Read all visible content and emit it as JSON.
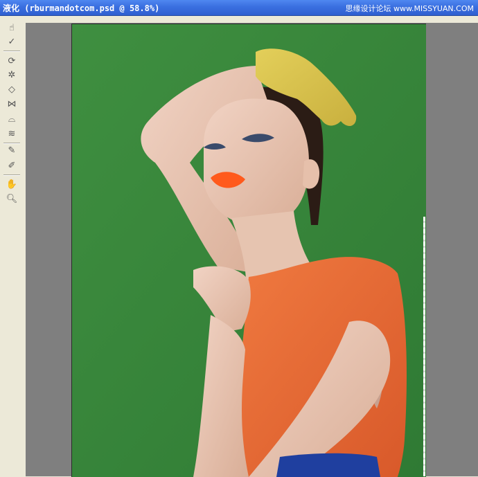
{
  "window": {
    "title": "液化 (rburmandotcom.psd @ 58.8%)",
    "watermark": "思缘设计论坛 www.MISSYUAN.COM"
  },
  "tools": [
    {
      "name": "forward-warp-tool",
      "glyph": "☝"
    },
    {
      "name": "reconstruct-tool",
      "glyph": "✓"
    },
    {
      "name": "twirl-clockwise-tool",
      "glyph": "⟳"
    },
    {
      "name": "pucker-tool",
      "glyph": "✲"
    },
    {
      "name": "bloat-tool",
      "glyph": "◇"
    },
    {
      "name": "push-left-tool",
      "glyph": "⋈"
    },
    {
      "name": "mirror-tool",
      "glyph": "⌓"
    },
    {
      "name": "turbulence-tool",
      "glyph": "≋"
    },
    {
      "name": "freeze-mask-tool",
      "glyph": "✎"
    },
    {
      "name": "thaw-mask-tool",
      "glyph": "✐"
    },
    {
      "name": "hand-tool",
      "glyph": "✋"
    },
    {
      "name": "zoom-tool",
      "glyph": "🔍︎"
    }
  ],
  "canvas": {
    "background_color": "#3e8c3f",
    "subject": "woman in orange dress with yellow glove"
  }
}
